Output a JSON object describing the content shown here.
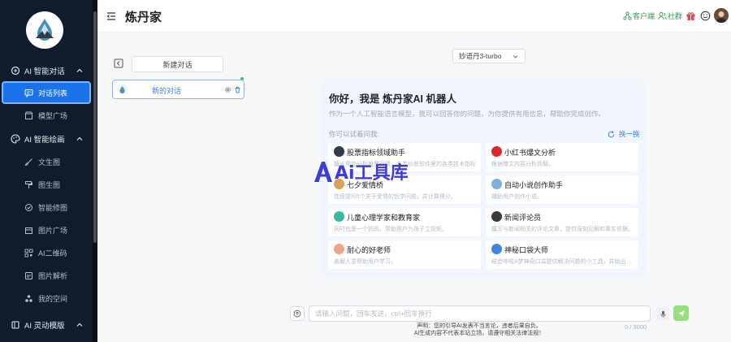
{
  "sidebar": {
    "groups": [
      {
        "label": "AI 智能对话",
        "icon": "chat-bot-icon"
      },
      {
        "label": "AI 智能绘画",
        "icon": "palette-icon"
      },
      {
        "label": "AI 灵动模版",
        "icon": "template-icon"
      }
    ],
    "items": [
      {
        "label": "对话列表",
        "icon": "message-square-icon",
        "active": true
      },
      {
        "label": "模型广场",
        "icon": "store-icon"
      },
      {
        "label": "文生图",
        "icon": "brush-icon"
      },
      {
        "label": "图生图",
        "icon": "paint-roller-icon"
      },
      {
        "label": "智能修图",
        "icon": "magic-icon"
      },
      {
        "label": "图片广场",
        "icon": "gallery-icon"
      },
      {
        "label": "AI二维码",
        "icon": "qrcode-icon"
      },
      {
        "label": "图片解析",
        "icon": "image-scan-icon"
      },
      {
        "label": "我的空间",
        "icon": "space-icon"
      }
    ]
  },
  "header": {
    "title": "炼丹家",
    "client_link": "客户端",
    "community_link": "社群"
  },
  "conversations": {
    "new_chat_label": "新建对话",
    "items": [
      {
        "label": "新的对话"
      }
    ]
  },
  "model_select": {
    "value": "妙语丹3-turbo"
  },
  "welcome": {
    "title": "你好，我是 炼丹家AI 机器人",
    "subtitle": "作为一个人工智能语言模型，我可以回答你的问题，为你提供有用信息，帮助你完成创作。",
    "hint": "你可以试着问我:",
    "refresh_label": "换一换",
    "cards": [
      {
        "title": "股票指标领域助手",
        "desc": "擅长帮你分析股票行情，各类炒股软件里的各类技术指标",
        "icon_color": "#2f3a4a"
      },
      {
        "title": "小红书爆文分析",
        "desc": "根据爆文内容分析拆解。",
        "icon_color": "#e0262b"
      },
      {
        "title": "七夕爱情桥",
        "desc": "连续提问5个关于爱情的哲学问题，并计算得分。",
        "icon_color": "#d9a25a"
      },
      {
        "title": "自动小说创作助手",
        "desc": "辅助用户创作小说。",
        "icon_color": "#7fb0d8"
      },
      {
        "title": "儿童心理学家和教育家",
        "desc": "同时也是一个妈妈，帮助用户为孩子立规矩。",
        "icon_color": "#36b9a0"
      },
      {
        "title": "新闻评论员",
        "desc": "擅写与新闻相关的评论文章，提供深刻见解和事实依据。",
        "icon_color": "#3a3a3a"
      },
      {
        "title": "耐心的好老师",
        "desc": "善解人意帮助用户学习。",
        "icon_color": "#f0a487"
      },
      {
        "title": "神秘口袋大师",
        "desc": "结合哆啦A梦神奇口袋提供解决问题的小工具，并给出方法",
        "icon_color": "#3e86e0"
      }
    ]
  },
  "overlay_brand": "Ai工具库",
  "input": {
    "placeholder": "请输入问题，回车发送，ctrl+回车换行",
    "value": "",
    "char_count": "0 / 3000"
  },
  "disclaimer": {
    "line1": "声明：您的引导AI发表不当言论，违者后果自负。",
    "line2": "AI生成内容不代表本站立场，请遵守相关法律法规！"
  },
  "colors": {
    "sidebar_bg": "#0f1c2c",
    "accent": "#1a73e8",
    "green": "#2e9e4f",
    "brand_purple": "#3f3bd8"
  }
}
